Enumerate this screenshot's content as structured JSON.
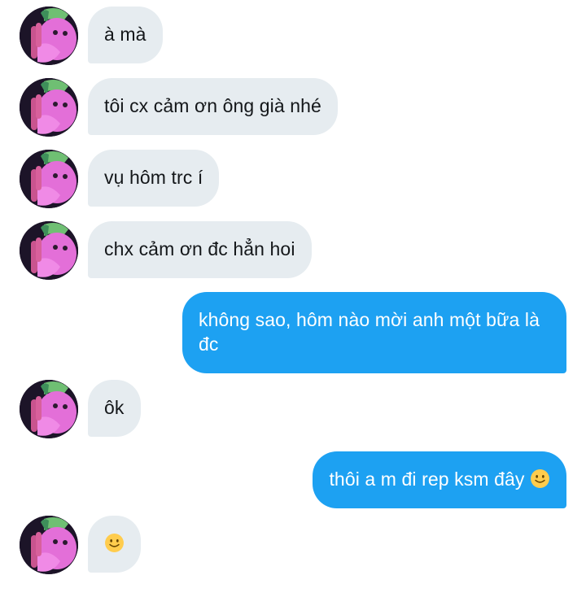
{
  "messages": [
    {
      "from": "them",
      "text": "à mà"
    },
    {
      "from": "them",
      "text": "tôi cx cảm ơn ông già nhé"
    },
    {
      "from": "them",
      "text": "vụ hôm trc í"
    },
    {
      "from": "them",
      "text": "chx cảm ơn đc hẳn hoi"
    },
    {
      "from": "me",
      "text": "không sao, hôm nào mời anh một bữa là đc"
    },
    {
      "from": "them",
      "text": "ôk"
    },
    {
      "from": "me",
      "text": "thôi a m đi rep ksm đây",
      "emoji": "slightly-smiling-face"
    },
    {
      "from": "them",
      "text": "",
      "emoji": "slightly-smiling-face"
    }
  ],
  "colors": {
    "incoming_bubble": "#e6ecf0",
    "incoming_text": "#14171a",
    "outgoing_bubble": "#1da1f2",
    "outgoing_text": "#ffffff",
    "avatar_face": "#e36fd8",
    "avatar_hair": "#6fbf73"
  }
}
